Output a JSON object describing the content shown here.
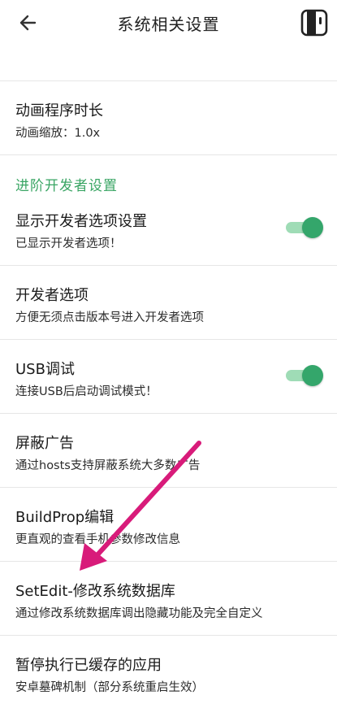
{
  "appbar": {
    "title": "系统相关设置",
    "back_icon": "arrow-left-icon",
    "action_icon": "phone-frame-icon"
  },
  "cut_row": {
    "subtitle": ""
  },
  "rows_top": [
    {
      "title": "动画程序时长",
      "subtitle": "动画缩放：1.0x"
    }
  ],
  "section": {
    "label": "进阶开发者设置",
    "color": "#3aa564"
  },
  "rows": [
    {
      "title": "显示开发者选项设置",
      "subtitle": "已显示开发者选项！",
      "toggle": true
    },
    {
      "title": "开发者选项",
      "subtitle": "方便无须点击版本号进入开发者选项",
      "toggle": false
    },
    {
      "title": "USB调试",
      "subtitle": "连接USB后启动调试模式！",
      "toggle": true
    },
    {
      "title": "屏蔽广告",
      "subtitle": "通过hosts支持屏蔽系统大多数广告",
      "toggle": false
    },
    {
      "title": "BuildProp编辑",
      "subtitle": "更直观的查看手机参数修改信息",
      "toggle": false
    },
    {
      "title": "SetEdit-修改系统数据库",
      "subtitle": "通过修改系统数据库调出隐藏功能及完全自定义",
      "toggle": false
    },
    {
      "title": "暂停执行已缓存的应用",
      "subtitle": "安卓墓碑机制（部分系统重启生效）",
      "toggle": false
    }
  ],
  "colors": {
    "accent": "#34a66b",
    "switch_track": "#9fdcb6",
    "annotation_arrow": "#d81b7a"
  }
}
